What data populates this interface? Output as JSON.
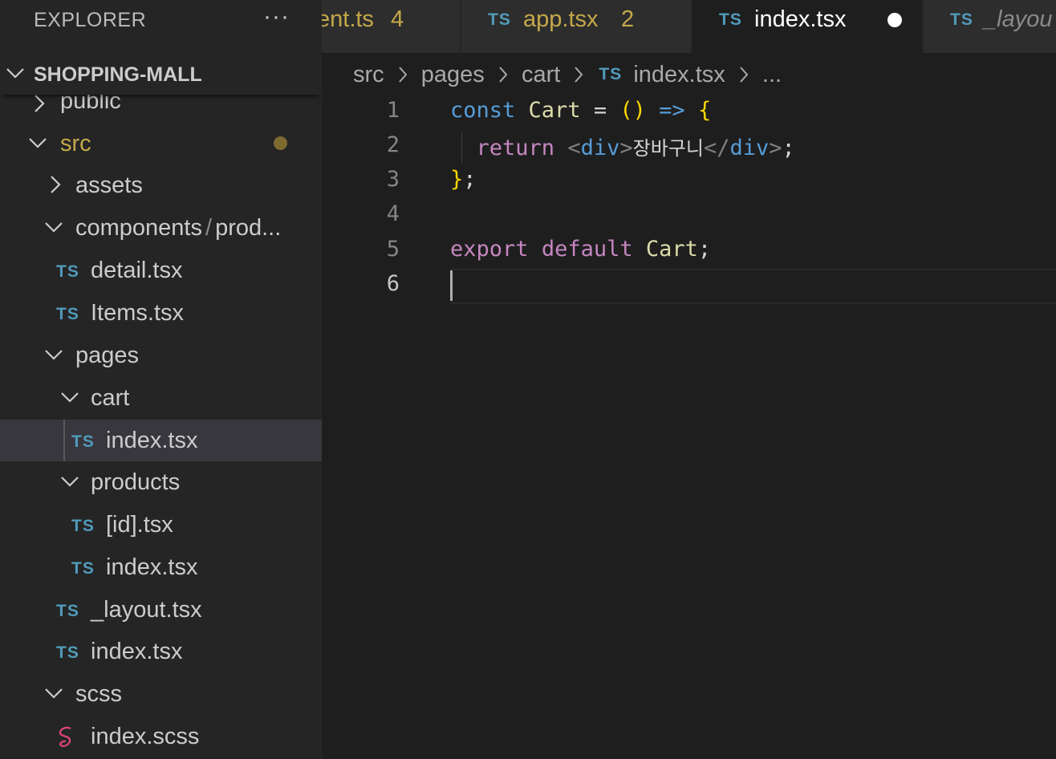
{
  "sidebar": {
    "title": "EXPLORER",
    "more": "···",
    "folder": "SHOPPING-MALL",
    "items": [
      {
        "label": "public"
      },
      {
        "label": "src"
      },
      {
        "label": "assets"
      },
      {
        "label": "components",
        "sub": "prod..."
      },
      {
        "label": "detail.tsx",
        "icon": "TS"
      },
      {
        "label": "Items.tsx",
        "icon": "TS"
      },
      {
        "label": "pages"
      },
      {
        "label": "cart"
      },
      {
        "label": "index.tsx",
        "icon": "TS"
      },
      {
        "label": "products"
      },
      {
        "label": "[id].tsx",
        "icon": "TS"
      },
      {
        "label": "index.tsx",
        "icon": "TS"
      },
      {
        "label": "_layout.tsx",
        "icon": "TS"
      },
      {
        "label": "index.tsx",
        "icon": "TS"
      },
      {
        "label": "scss"
      },
      {
        "label": "index.scss"
      }
    ]
  },
  "tabs": [
    {
      "label": "ent.ts",
      "count": "4"
    },
    {
      "icon": "TS",
      "label": "app.tsx",
      "count": "2"
    },
    {
      "icon": "TS",
      "label": "index.tsx"
    },
    {
      "icon": "TS",
      "label": "_layou"
    }
  ],
  "breadcrumb": {
    "parts": [
      "src",
      "pages",
      "cart"
    ],
    "icon": "TS",
    "file": "index.tsx",
    "more": "..."
  },
  "editor": {
    "line_numbers": [
      "1",
      "2",
      "3",
      "4",
      "5",
      "6"
    ],
    "line1": {
      "kw": "const",
      "name": "Cart",
      "eq": "=",
      "parens": "()",
      "arrow": "=>",
      "brace": "{"
    },
    "line2": {
      "kw": "return",
      "lt": "<",
      "tag": "div",
      "gt": ">",
      "text": "장바구니",
      "close_lt": "</",
      "close_tag": "div",
      "close_gt": ">",
      "semi": ";"
    },
    "line3": {
      "brace": "}",
      "semi": ";"
    },
    "line5": {
      "kw1": "export",
      "kw2": "default",
      "name": "Cart",
      "semi": ";"
    }
  },
  "colors": {
    "ts_icon": "#519aba",
    "modified": "#c5a84a",
    "scss_icon": "#e0457b"
  }
}
